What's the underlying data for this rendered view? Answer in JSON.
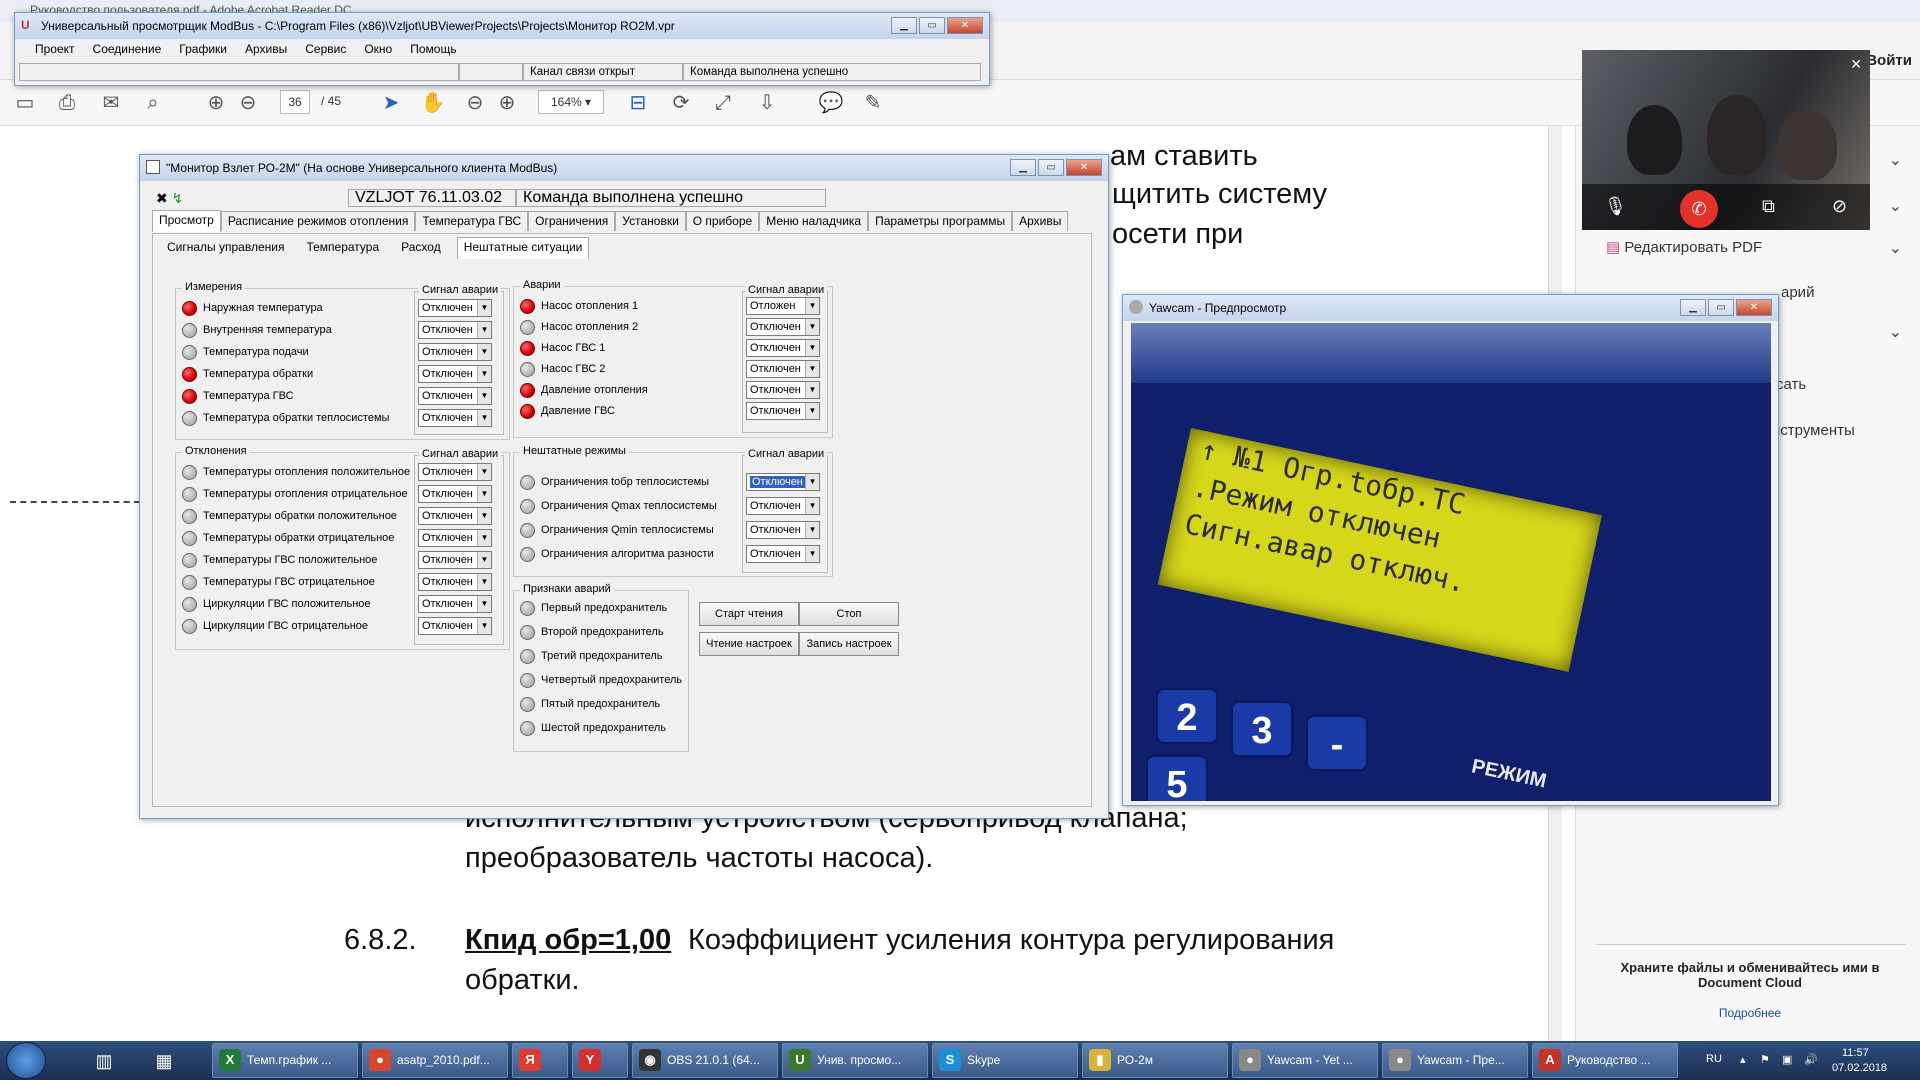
{
  "acrobat": {
    "title": "Руководство пользователя.pdf - Adobe Acrobat Reader DC",
    "login": "Войти",
    "page_current": "36",
    "page_total": "/ 45",
    "zoom": "164%",
    "doc_lines": [
      "ам ставить",
      "щитить систему",
      "осети при",
      "исполнительным устройством (сервопривод клапана;",
      "преобразователь частоты насоса)."
    ],
    "section_num": "6.8.2.",
    "section_bold": "Кпид обр=1,00",
    "section_text": "Коэффициент усиления контура регулирования",
    "section_text2": "обратки.",
    "right_pane": {
      "edit_pdf": "Редактировать PDF",
      "item2": "арий",
      "item3": "сать",
      "item4": "нструменты"
    },
    "cloud_text": "Храните файлы и обменивайтесь ими в Document Cloud",
    "cloud_link": "Подробнее"
  },
  "modbus_main": {
    "title": "Универсальный просмотрщик ModBus - C:\\Program Files (x86)\\Vzljot\\UBViewerProjects\\Projects\\Монитор RO2M.vpr",
    "menu": [
      "Проект",
      "Соединение",
      "Графики",
      "Архивы",
      "Сервис",
      "Окно",
      "Помощь"
    ],
    "status_channel": "Канал связи открыт",
    "status_command": "Команда выполнена успешно"
  },
  "monitor": {
    "title": "\"Монитор Взлет РО-2М\" (На основе Универсального клиента ModBus)",
    "device": "VZLJOT 76.11.03.02",
    "status": "Команда выполнена успешно",
    "tabs": [
      "Просмотр",
      "Расписание режимов отопления",
      "Температура ГВС",
      "Ограничения",
      "Установки",
      "О приборе",
      "Меню наладчика",
      "Параметры программы",
      "Архивы"
    ],
    "subtabs": [
      "Сигналы управления",
      "Температура",
      "Расход",
      "Нештатные ситуации"
    ],
    "alarm_signal_header": "Сигнал аварии",
    "measurements": {
      "title": "Измерения",
      "rows": [
        {
          "label": "Наружная температура",
          "state": "red",
          "select": "Отключен"
        },
        {
          "label": "Внутренняя температура",
          "state": "off",
          "select": "Отключен"
        },
        {
          "label": "Температура подачи",
          "state": "off",
          "select": "Отключен"
        },
        {
          "label": "Температура обратки",
          "state": "red",
          "select": "Отключен"
        },
        {
          "label": "Температура ГВС",
          "state": "red",
          "select": "Отключен"
        },
        {
          "label": "Температура обратки теплосистемы",
          "state": "off",
          "select": "Отключен"
        }
      ]
    },
    "deviations": {
      "title": "Отклонения",
      "rows": [
        {
          "label": "Температуры отопления положительное",
          "select": "Отключен"
        },
        {
          "label": "Температуры отопления отрицательное",
          "select": "Отключен"
        },
        {
          "label": "Температуры обратки положительное",
          "select": "Отключен"
        },
        {
          "label": "Температуры обратки отрицательное",
          "select": "Отключен"
        },
        {
          "label": "Температуры ГВС положительное",
          "select": "Отключен"
        },
        {
          "label": "Температуры ГВС отрицательное",
          "select": "Отключен"
        },
        {
          "label": "Циркуляции ГВС положительное",
          "select": "Отключен"
        },
        {
          "label": "Циркуляции ГВС отрицательное",
          "select": "Отключен"
        }
      ]
    },
    "alarms": {
      "title": "Аварии",
      "rows": [
        {
          "label": "Насос отопления 1",
          "state": "red",
          "select": "Отложен"
        },
        {
          "label": "Насос отопления 2",
          "state": "off",
          "select": "Отключен"
        },
        {
          "label": "Насос ГВС 1",
          "state": "red",
          "select": "Отключен"
        },
        {
          "label": "Насос ГВС 2",
          "state": "off",
          "select": "Отключен"
        },
        {
          "label": "Давление отопления",
          "state": "red",
          "select": "Отключен"
        },
        {
          "label": "Давление ГВС",
          "state": "red",
          "select": "Отключен"
        }
      ]
    },
    "abnormal": {
      "title": "Нештатные режимы",
      "rows": [
        {
          "label": "Ограничения tобр теплосистемы",
          "select": "Отключен"
        },
        {
          "label": "Ограничения Qmax теплосистемы",
          "select": "Отключен"
        },
        {
          "label": "Ограничения Qmin теплосистемы",
          "select": "Отключен"
        },
        {
          "label": "Ограничения алгоритма разности",
          "select": "Отключен"
        }
      ]
    },
    "signs": {
      "title": "Признаки аварий",
      "rows": [
        "Первый предохранитель",
        "Второй предохранитель",
        "Третий предохранитель",
        "Четвертый предохранитель",
        "Пятый предохранитель",
        "Шестой предохранитель"
      ]
    },
    "buttons": {
      "start": "Старт чтения",
      "stop": "Стоп",
      "read": "Чтение настроек",
      "write": "Запись настроек"
    }
  },
  "yawcam": {
    "title": "Yawcam - Предпросмотр",
    "lcd_lines": [
      "↑ №1 Огр.tобр.TC",
      ".Режим     отключен",
      "Сигн.авар отключ."
    ],
    "keys": [
      "2",
      "3",
      "-",
      "5"
    ],
    "panel_label": "РЕЖИМ"
  },
  "taskbar": {
    "tasks": [
      {
        "label": "Темп.график ...",
        "icon": "X",
        "color": "#1f7a3c"
      },
      {
        "label": "asatp_2010.pdf...",
        "icon": "●",
        "color": "#d9442b"
      },
      {
        "label": "",
        "icon": "Я",
        "color": "#e23a2e"
      },
      {
        "label": "",
        "icon": "Y",
        "color": "#d62d2d"
      },
      {
        "label": "OBS 21.0.1 (64...",
        "icon": "◉",
        "color": "#333333"
      },
      {
        "label": "Унив. просмо...",
        "icon": "U",
        "color": "#3a7a2a"
      },
      {
        "label": "Skype",
        "icon": "S",
        "color": "#1a8fd6"
      },
      {
        "label": "РО-2м",
        "icon": "▮",
        "color": "#d9b23a"
      },
      {
        "label": "Yawcam - Yet ...",
        "icon": "●",
        "color": "#888888"
      },
      {
        "label": "Yawcam - Пре...",
        "icon": "●",
        "color": "#888888"
      },
      {
        "label": "Руководство ...",
        "icon": "A",
        "color": "#c8302a"
      }
    ],
    "lang": "RU",
    "time": "11:57",
    "date": "07.02.2018"
  }
}
